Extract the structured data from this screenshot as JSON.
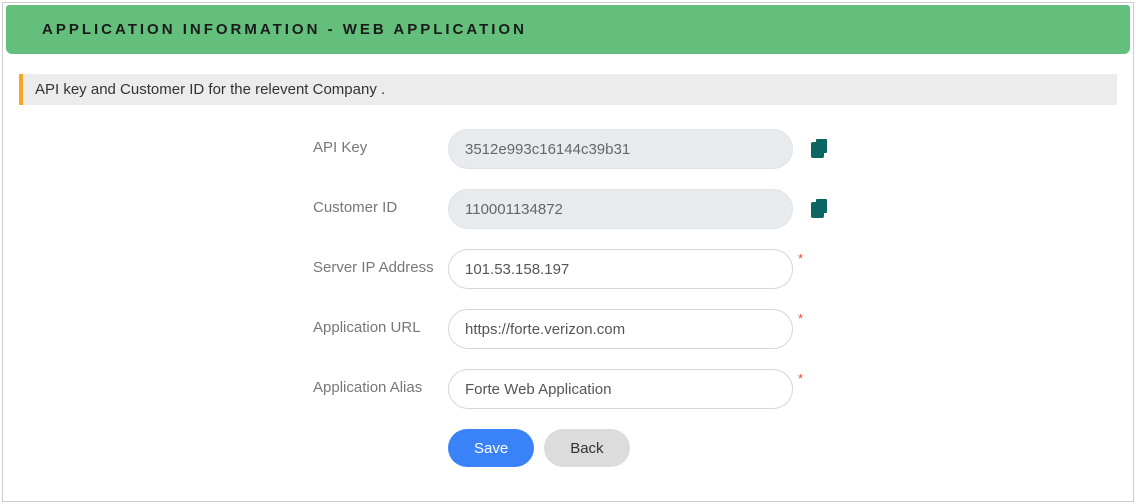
{
  "header": {
    "title": "APPLICATION INFORMATION - WEB APPLICATION"
  },
  "info_bar": {
    "text": "API key and Customer ID for the relevent Company ."
  },
  "form": {
    "api_key": {
      "label": "API Key",
      "value": "3512e993c16144c39b31"
    },
    "customer_id": {
      "label": "Customer ID",
      "value": "110001134872"
    },
    "server_ip": {
      "label": "Server IP Address",
      "value": "101.53.158.197"
    },
    "app_url": {
      "label": "Application URL",
      "value": "https://forte.verizon.com"
    },
    "app_alias": {
      "label": "Application Alias",
      "value": "Forte Web Application"
    }
  },
  "buttons": {
    "save": "Save",
    "back": "Back"
  }
}
